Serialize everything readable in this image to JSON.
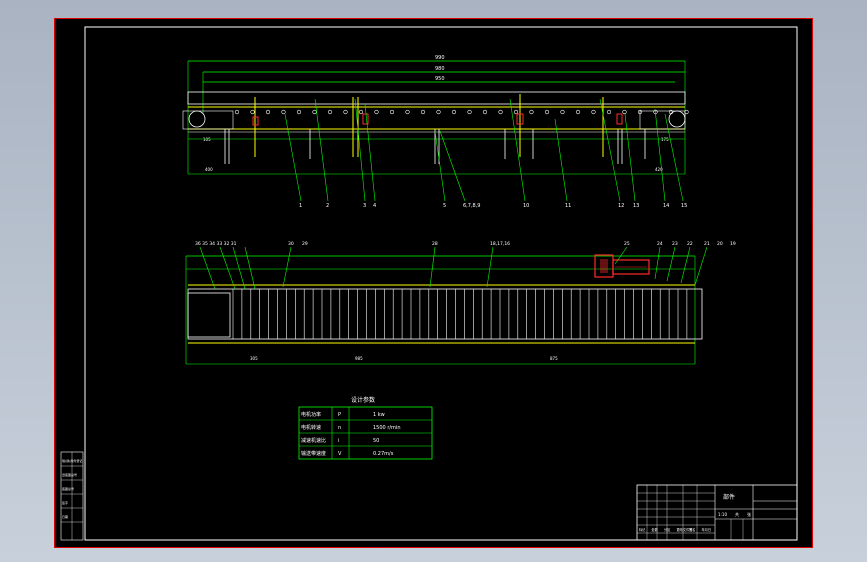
{
  "colors": {
    "background": "#000000",
    "border": "#ff2a2a",
    "dimension": "#00ff00",
    "outline": "#ffff00",
    "table": "#00ff00",
    "text": "#ffffff"
  },
  "top_view": {
    "dim_overall": "990",
    "dim_upper": "980",
    "dim_mid": "950",
    "dim_left": "400",
    "dim_right": "420",
    "dim_small_left": "105",
    "dim_small_right": "175",
    "callouts": [
      "1",
      "2",
      "3",
      "4",
      "5",
      "6,7,8,9",
      "10",
      "11",
      "12",
      "13",
      "14",
      "15"
    ]
  },
  "plan_view": {
    "callouts_top": [
      "36 35 34 33 32 31",
      "30",
      "29",
      "28",
      "18,17,16",
      "25",
      "24",
      "23",
      "22",
      "21",
      "20",
      "19"
    ],
    "dim_bottom_left": "305",
    "dim_bottom_mid": "985",
    "dim_bottom_right": "875"
  },
  "design_params": {
    "title": "设计参数",
    "rows": [
      {
        "name": "电机功率",
        "symbol": "P",
        "value": "1 kw"
      },
      {
        "name": "电机转速",
        "symbol": "n",
        "value": "1500 r/min"
      },
      {
        "name": "减速机速比",
        "symbol": "i",
        "value": "50"
      },
      {
        "name": "输送带速度",
        "symbol": "V",
        "value": "0.27m/s"
      }
    ]
  },
  "title_block": {
    "drawing_name": "部件",
    "row_labels": [
      "标记",
      "处数",
      "分区",
      "更改文件号",
      "签名",
      "年月日"
    ],
    "scale": "1:10",
    "sheet_a": "共",
    "sheet_b": "张"
  },
  "left_strip": {
    "labels": [
      "借(通)用件登记",
      "旧底图总号",
      "底图总号",
      "签字",
      "日期"
    ]
  }
}
